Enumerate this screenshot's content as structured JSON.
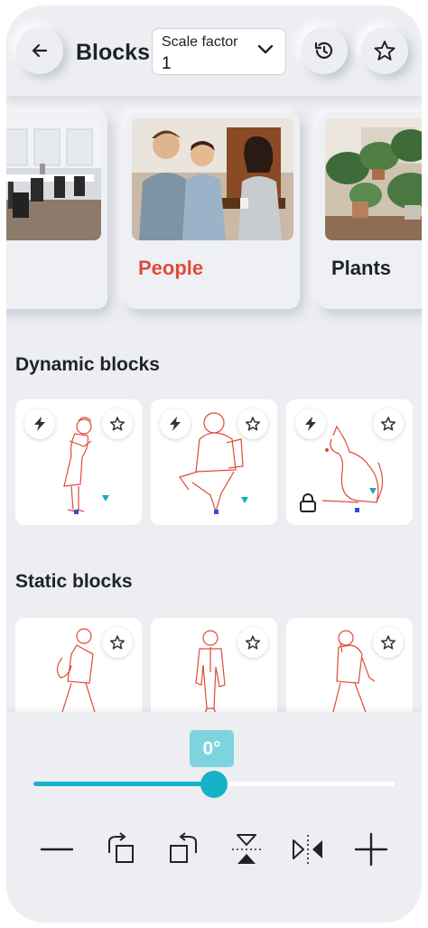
{
  "header": {
    "title": "Blocks",
    "scale_label": "Scale factor",
    "scale_value": "1"
  },
  "icons": {
    "back": "arrow-left-icon",
    "history": "history-icon",
    "favorite": "star-icon"
  },
  "categories": [
    {
      "label": "",
      "image": "office-photo"
    },
    {
      "label": "People",
      "image": "people-photo",
      "active": true
    },
    {
      "label": "Plants",
      "image": "plants-photo"
    }
  ],
  "sections": {
    "dynamic": "Dynamic blocks",
    "static": "Static blocks"
  },
  "dynamic_blocks": [
    {
      "name": "woman-hugging-dynamic",
      "flags": [
        "bolt-icon",
        "star-icon"
      ]
    },
    {
      "name": "man-sitting-reading-dynamic",
      "flags": [
        "bolt-icon",
        "star-icon"
      ]
    },
    {
      "name": "cat-dynamic",
      "flags": [
        "bolt-icon",
        "star-icon",
        "lock-icon"
      ]
    }
  ],
  "static_blocks": [
    {
      "name": "man-walking-bag"
    },
    {
      "name": "man-suit-standing"
    },
    {
      "name": "man-walking-phone"
    }
  ],
  "rotation": {
    "angle_label": "0°",
    "slider_fraction": 0.5
  },
  "toolbar": [
    "minus-icon",
    "rotate-cw-icon",
    "rotate-ccw-icon",
    "flip-vertical-icon",
    "flip-horizontal-icon",
    "plus-icon"
  ],
  "colors": {
    "accent": "#16b2c8",
    "active_category": "#e04a37",
    "drawing": "#e04a37",
    "background": "#eceef2"
  }
}
